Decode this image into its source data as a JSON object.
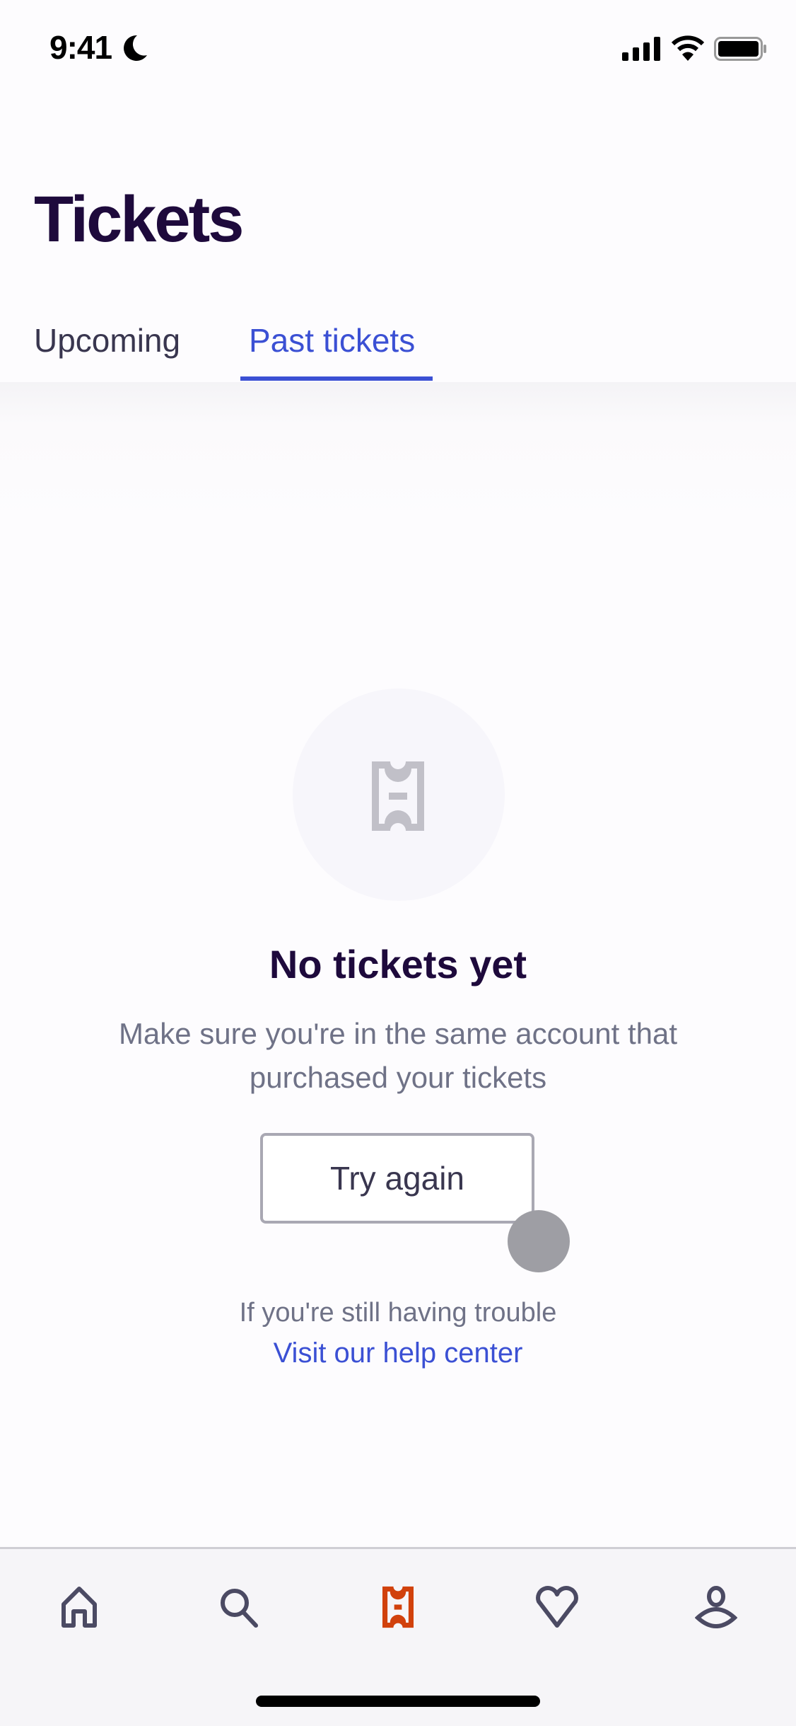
{
  "status_bar": {
    "time": "9:41",
    "icons": [
      "moon-icon",
      "signal-icon",
      "wifi-icon",
      "battery-icon"
    ]
  },
  "header": {
    "title": "Tickets"
  },
  "tabs": [
    {
      "label": "Upcoming",
      "active": false
    },
    {
      "label": "Past tickets",
      "active": true
    }
  ],
  "empty_state": {
    "icon": "ticket-icon",
    "title": "No tickets yet",
    "description": "Make sure you're in the same account that purchased your tickets",
    "button_label": "Try again",
    "trouble_text": "If you're still having trouble",
    "help_link": "Visit our help center"
  },
  "bottom_nav": [
    {
      "name": "home",
      "icon": "home-icon",
      "active": false
    },
    {
      "name": "search",
      "icon": "search-icon",
      "active": false
    },
    {
      "name": "tickets",
      "icon": "ticket-icon",
      "active": true
    },
    {
      "name": "likes",
      "icon": "heart-icon",
      "active": false
    },
    {
      "name": "profile",
      "icon": "profile-icon",
      "active": false
    }
  ],
  "colors": {
    "brand_dark": "#1e0a3c",
    "accent_blue": "#3b50d4",
    "active_nav": "#d1410c",
    "muted_text": "#6f7287"
  }
}
